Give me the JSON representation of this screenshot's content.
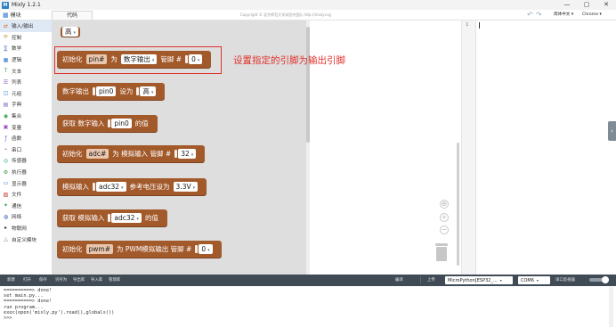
{
  "app": {
    "logo_text": "M",
    "title": "Mixly 1.2.1"
  },
  "window_controls": {
    "minimize": "—",
    "maximize": "▢",
    "close": "✕"
  },
  "header": {
    "category_label": "模块",
    "code_tab": "代码",
    "copyright": "Copyright © 北京师范大学米思齐团队 http://mixly.org",
    "language_select": "简体中文 ▾",
    "browser_select": "Chrome ▾"
  },
  "sidebar": {
    "items": [
      {
        "label": "输入/输出",
        "icon": "io-icon",
        "glyph": "⇄",
        "color": "#d36b2f"
      },
      {
        "label": "控制",
        "icon": "control-icon",
        "glyph": "⟳",
        "color": "#c38d21"
      },
      {
        "label": "数学",
        "icon": "math-icon",
        "glyph": "∑",
        "color": "#2b5fb3"
      },
      {
        "label": "逻辑",
        "icon": "logic-icon",
        "glyph": "▦",
        "color": "#2b7ad0"
      },
      {
        "label": "文本",
        "icon": "text-icon",
        "glyph": "T",
        "color": "#3aa04a"
      },
      {
        "label": "列表",
        "icon": "list-icon",
        "glyph": "☰",
        "color": "#8a56c6"
      },
      {
        "label": "元组",
        "icon": "tuple-icon",
        "glyph": "◫",
        "color": "#4b8ed6"
      },
      {
        "label": "字典",
        "icon": "dict-icon",
        "glyph": "▤",
        "color": "#7b5bc4"
      },
      {
        "label": "集合",
        "icon": "set-icon",
        "glyph": "◉",
        "color": "#3aa04a"
      },
      {
        "label": "变量",
        "icon": "variable-icon",
        "glyph": "▣",
        "color": "#9b4fc3"
      },
      {
        "label": "函数",
        "icon": "function-icon",
        "glyph": "ƒ",
        "color": "#5b6bc0"
      },
      {
        "label": "串口",
        "icon": "serial-icon",
        "glyph": "⌁",
        "color": "#c84b7a"
      },
      {
        "label": "传感器",
        "icon": "sensor-icon",
        "glyph": "◎",
        "color": "#2a9d8f"
      },
      {
        "label": "执行器",
        "icon": "actuator-icon",
        "glyph": "⚙",
        "color": "#3a8e3a"
      },
      {
        "label": "显示器",
        "icon": "display-icon",
        "glyph": "▭",
        "color": "#2b7ad0"
      },
      {
        "label": "文件",
        "icon": "file-icon",
        "glyph": "▧",
        "color": "#c0392b"
      },
      {
        "label": "通信",
        "icon": "communication-icon",
        "glyph": "✦",
        "color": "#3aa04a"
      },
      {
        "label": "网络",
        "icon": "network-icon",
        "glyph": "◍",
        "color": "#2b5fb3"
      },
      {
        "label": "物联网",
        "icon": "iot-icon",
        "glyph": "▸",
        "color": "#333333"
      },
      {
        "label": "自定义模块",
        "icon": "custom-module-icon",
        "glyph": "△",
        "color": "#777777"
      }
    ]
  },
  "blocks": {
    "high_value": "高",
    "init_pin": {
      "t1": "初始化",
      "var": "pin#",
      "t2": "为",
      "mode": "数字输出",
      "t3": "管脚 #",
      "pin": "0"
    },
    "digital_out": {
      "t1": "数字输出",
      "var": "pin0",
      "t2": "设为",
      "value": "高"
    },
    "digital_in": {
      "t1": "获取 数字输入",
      "var": "pin0",
      "t2": "的值"
    },
    "init_adc": {
      "t1": "初始化",
      "var": "adc#",
      "t2": "为 模拟输入 管脚 #",
      "pin": "32"
    },
    "analog_in_vref": {
      "t1": "模拟输入",
      "var": "adc32",
      "t2": "参考电压设为",
      "value": "3.3V"
    },
    "analog_in_get": {
      "t1": "获取 模拟输入",
      "var": "adc32",
      "t2": "的值"
    },
    "init_pwm": {
      "t1": "初始化",
      "var": "pwm#",
      "t2": "为 PWM模拟输出 管脚 #",
      "pin": "0"
    }
  },
  "annotation": "设置指定的引脚为输出引脚",
  "editor": {
    "line_number": "1",
    "collapse_glyph": "›"
  },
  "bottombar": {
    "buttons": [
      "新建",
      "打开",
      "保存",
      "另存为",
      "导出库",
      "导入库",
      "管理库"
    ],
    "compile": "编译",
    "upload": "上传",
    "board": "MicroPython[ESP32_...",
    "port": "COM6",
    "serial_monitor": "串口监视器"
  },
  "console": {
    "lines": [
      "==========> done!",
      "set main.py...",
      "==========> done!",
      "run program...",
      "exec(open('mixly.py').read(),globals())",
      ">>>"
    ]
  },
  "colors": {
    "block": "#a35a2b",
    "annotation": "#e0302b",
    "bottombar": "#404b56"
  }
}
